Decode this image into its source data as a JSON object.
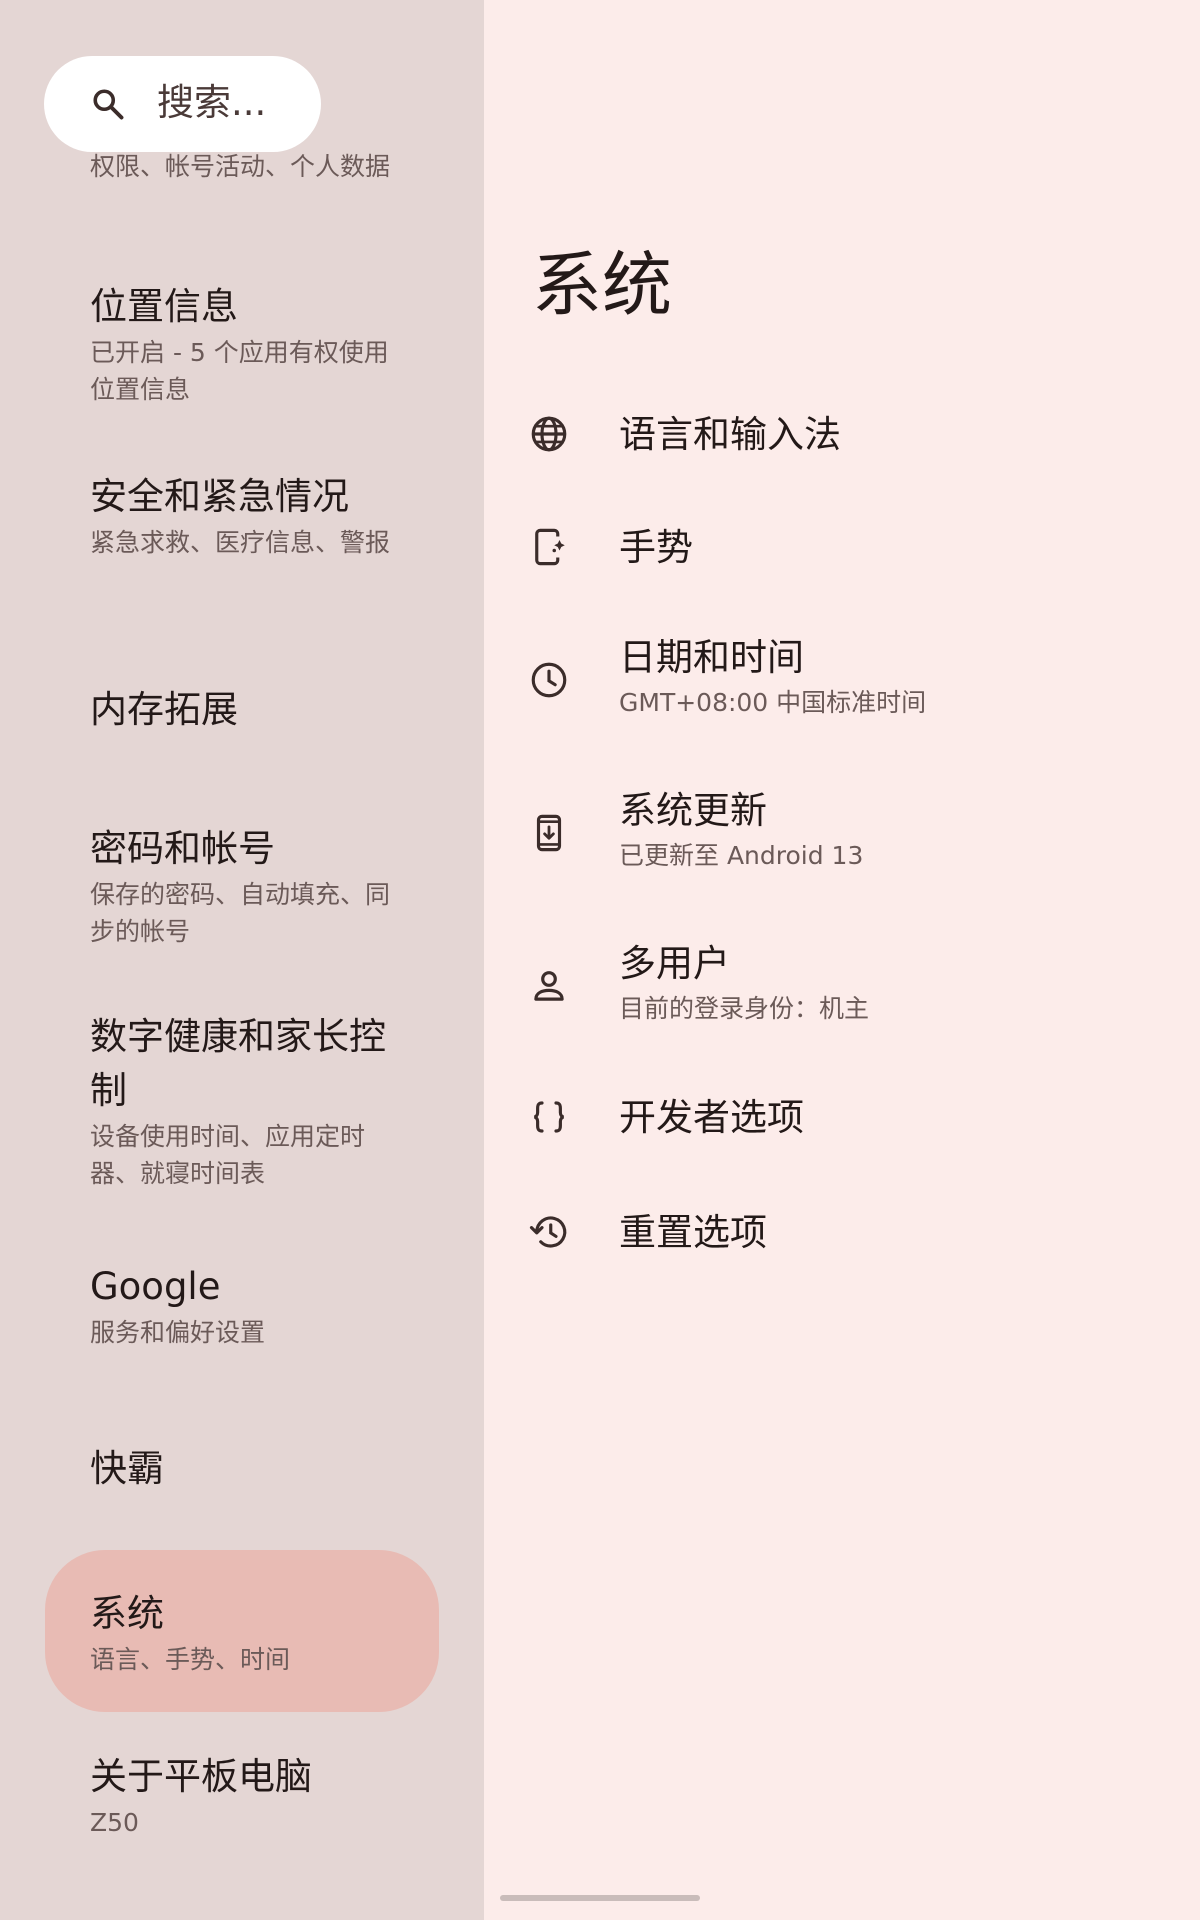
{
  "search": {
    "placeholder": "搜索..."
  },
  "nav": {
    "items": [
      {
        "title": "",
        "subtitle": "权限、帐号活动、个人数据"
      },
      {
        "title": "位置信息",
        "subtitle": "已开启 - 5 个应用有权使用位置信息"
      },
      {
        "title": "安全和紧急情况",
        "subtitle": "紧急求救、医疗信息、警报"
      },
      {
        "title": "内存拓展",
        "subtitle": ""
      },
      {
        "title": "密码和帐号",
        "subtitle": "保存的密码、自动填充、同步的帐号"
      },
      {
        "title": "数字健康和家长控制",
        "subtitle": "设备使用时间、应用定时器、就寝时间表"
      },
      {
        "title": "Google",
        "subtitle": "服务和偏好设置"
      },
      {
        "title": "快霸",
        "subtitle": ""
      },
      {
        "title": "系统",
        "subtitle": "语言、手势、时间",
        "selected": true
      },
      {
        "title": "关于平板电脑",
        "subtitle": "Z50"
      }
    ]
  },
  "detail": {
    "title": "系统",
    "settings": [
      {
        "title": "语言和输入法",
        "subtitle": "",
        "icon": "globe-icon"
      },
      {
        "title": "手势",
        "subtitle": "",
        "icon": "gesture-phone-icon"
      },
      {
        "title": "日期和时间",
        "subtitle": "GMT+08:00 中国标准时间",
        "icon": "clock-icon"
      },
      {
        "title": "系统更新",
        "subtitle": "已更新至 Android 13",
        "icon": "system-update-icon"
      },
      {
        "title": "多用户",
        "subtitle": "目前的登录身份：机主",
        "icon": "person-icon"
      },
      {
        "title": "开发者选项",
        "subtitle": "",
        "icon": "braces-icon"
      },
      {
        "title": "重置选项",
        "subtitle": "",
        "icon": "history-icon"
      }
    ]
  },
  "colors": {
    "nav_background": "#e4d6d4",
    "detail_background": "#fcecea",
    "selected_background": "#e8bbb4",
    "primary_text": "#231918",
    "secondary_text": "#6b5a58"
  }
}
